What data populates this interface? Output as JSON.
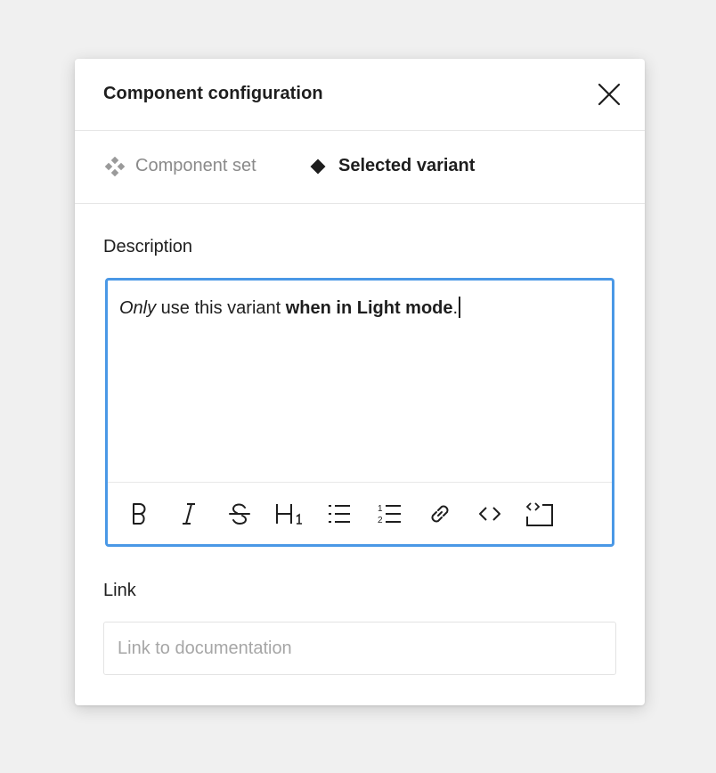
{
  "dialog": {
    "title": "Component configuration",
    "close_icon": "close-icon"
  },
  "tabs": [
    {
      "label": "Component set",
      "icon": "component-set-icon",
      "active": false
    },
    {
      "label": "Selected variant",
      "icon": "variant-diamond-icon",
      "active": true
    }
  ],
  "description": {
    "label": "Description",
    "text_italic": "Only",
    "text_plain": " use this variant ",
    "text_bold": "when in Light mode",
    "text_end": ".",
    "toolbar": [
      "bold-icon",
      "italic-icon",
      "strikethrough-icon",
      "heading-1-icon",
      "bullet-list-icon",
      "numbered-list-icon",
      "link-icon",
      "code-icon",
      "code-block-icon"
    ]
  },
  "link": {
    "label": "Link",
    "placeholder": "Link to documentation",
    "value": ""
  },
  "colors": {
    "accent": "#4a98e6",
    "text": "#1e1e1e",
    "muted": "#8a8a8a",
    "background": "#f0f0f0"
  }
}
